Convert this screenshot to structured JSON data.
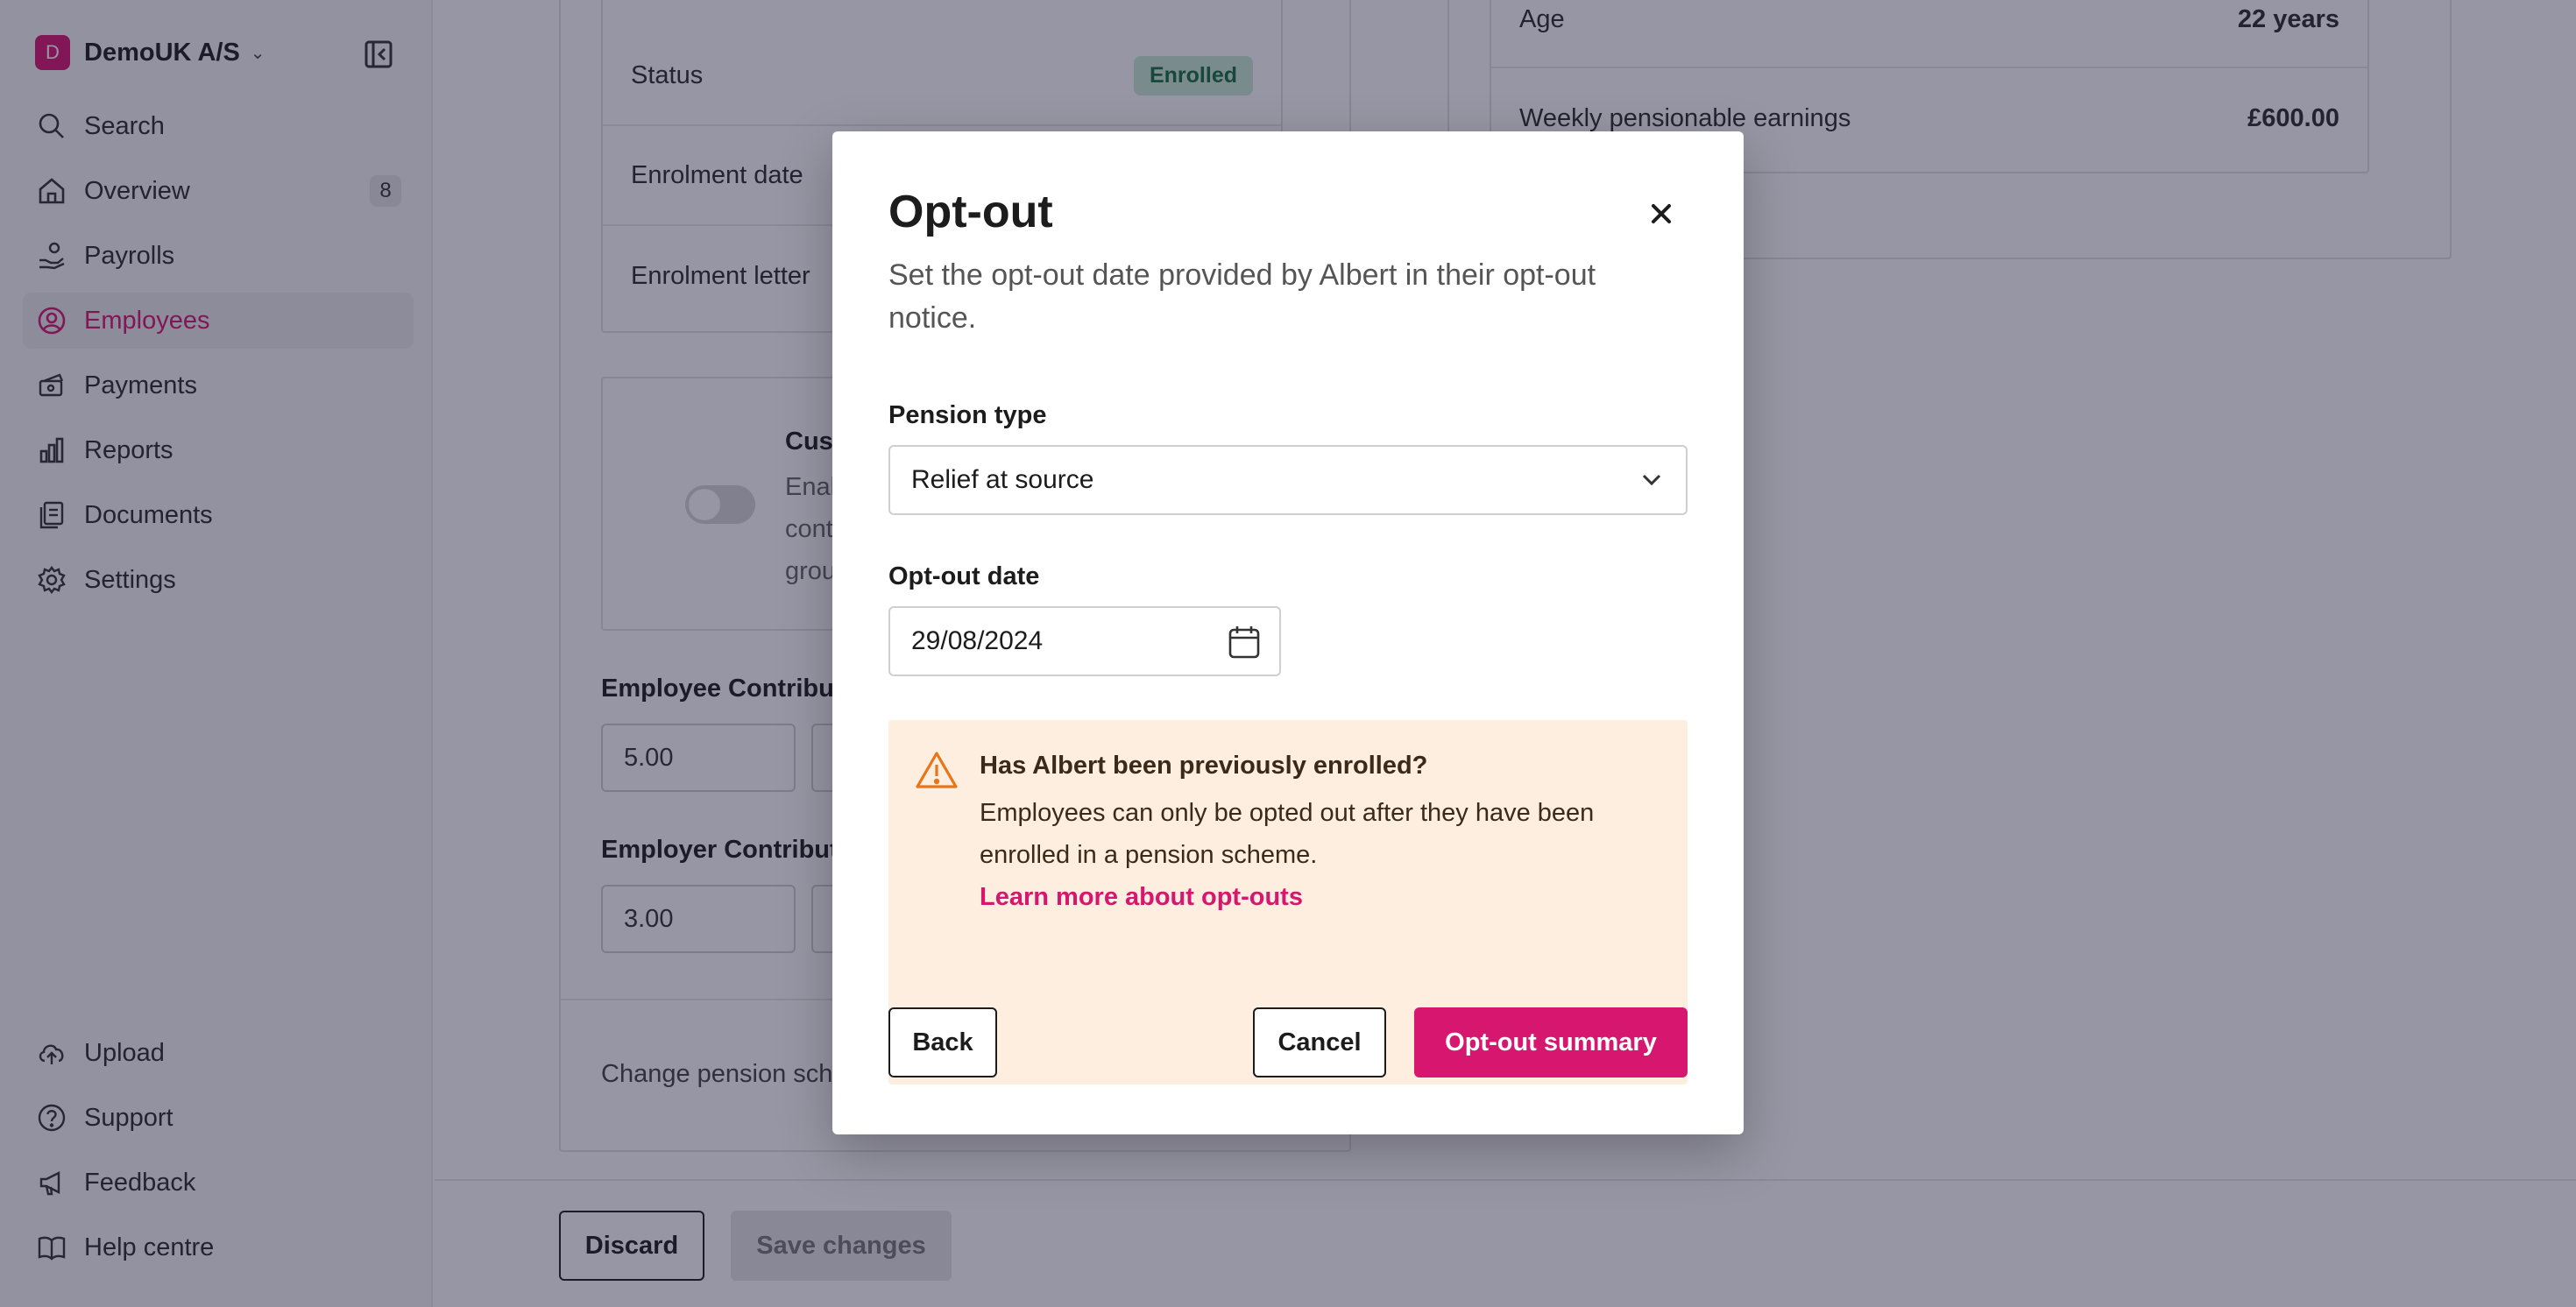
{
  "sidebar": {
    "company": {
      "initial": "D",
      "name": "DemoUK A/S"
    },
    "nav": [
      {
        "label": "Search",
        "icon": "search-icon"
      },
      {
        "label": "Overview",
        "icon": "home-icon",
        "count": "8"
      },
      {
        "label": "Payrolls",
        "icon": "payroll-icon"
      },
      {
        "label": "Employees",
        "icon": "user-circle-icon",
        "active": true
      },
      {
        "label": "Payments",
        "icon": "payments-icon"
      },
      {
        "label": "Reports",
        "icon": "bar-chart-icon"
      },
      {
        "label": "Documents",
        "icon": "documents-icon"
      },
      {
        "label": "Settings",
        "icon": "gear-icon"
      }
    ],
    "bottom_nav": [
      {
        "label": "Upload",
        "icon": "cloud-upload-icon"
      },
      {
        "label": "Support",
        "icon": "help-circle-icon"
      },
      {
        "label": "Feedback",
        "icon": "megaphone-icon"
      },
      {
        "label": "Help centre",
        "icon": "book-icon"
      }
    ]
  },
  "main": {
    "enrolment": {
      "status_label": "Status",
      "status_value": "Enrolled",
      "enrolment_date_label": "Enrolment date",
      "enrolment_letter_label": "Enrolment letter"
    },
    "custom": {
      "title": "Custom",
      "desc": "Enabling contributions group."
    },
    "employee_contrib_label": "Employee Contributions",
    "employee_contrib_value": "5.00",
    "employer_contrib_label": "Employer Contributions",
    "employer_contrib_value": "3.00",
    "change_scheme_label": "Change pension scheme",
    "info": {
      "age_label": "Age",
      "age_value": "22 years",
      "earnings_label": "Weekly pensionable earnings",
      "earnings_value": "£600.00"
    },
    "footer": {
      "discard": "Discard",
      "save": "Save changes"
    }
  },
  "modal": {
    "title": "Opt-out",
    "subtitle": "Set the opt-out date provided by Albert in their opt-out notice.",
    "pension_type_label": "Pension type",
    "pension_type_value": "Relief at source",
    "optout_date_label": "Opt-out date",
    "optout_date_value": "29/08/2024",
    "alert": {
      "title": "Has Albert been previously enrolled?",
      "text": "Employees can only be opted out after they have been enrolled in a pension scheme.",
      "link": "Learn more about opt-outs"
    },
    "buttons": {
      "back": "Back",
      "cancel": "Cancel",
      "summary": "Opt-out summary"
    }
  },
  "colors": {
    "brand": "#d6166f",
    "success_bg": "#c9ead5",
    "success_text": "#13703a",
    "warning_bg": "#fdeee0",
    "warning_icon": "#e8751a"
  }
}
